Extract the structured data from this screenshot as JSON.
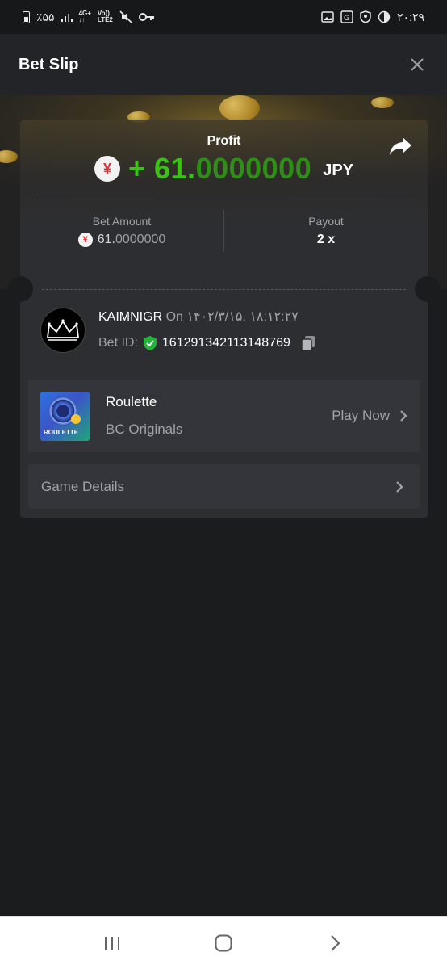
{
  "status_bar": {
    "battery_text": "٪۵۵",
    "net_top": "4G+",
    "net_bottom": "LTE2",
    "volte": "Vo))",
    "time": "۲۰:۲۹"
  },
  "header": {
    "title": "Bet Slip",
    "close_icon": "close-icon"
  },
  "profit": {
    "label": "Profit",
    "sign": "+",
    "value_main": "61.",
    "value_decimals": "0000000",
    "currency": "JPY",
    "currency_symbol": "¥"
  },
  "stats": {
    "bet_amount_label": "Bet Amount",
    "bet_amount_main": "61.",
    "bet_amount_decimals": "0000000",
    "payout_label": "Payout",
    "payout_value": "2 x"
  },
  "user": {
    "username": "KAIMNIGR",
    "on_label": "On",
    "datetime": "۱۴۰۲/۳/۱۵, ۱۸:۱۲:۲۷",
    "bet_id_label": "Bet ID:",
    "bet_id": "161291342113148769"
  },
  "game": {
    "name": "Roulette",
    "provider": "BC Originals",
    "thumb_tag": "ROULETTE",
    "play_label": "Play Now"
  },
  "details": {
    "label": "Game Details"
  },
  "colors": {
    "profit_green": "#3bc117",
    "background": "#1b1c1e",
    "card": "#2d2e31",
    "row": "#34353a"
  }
}
